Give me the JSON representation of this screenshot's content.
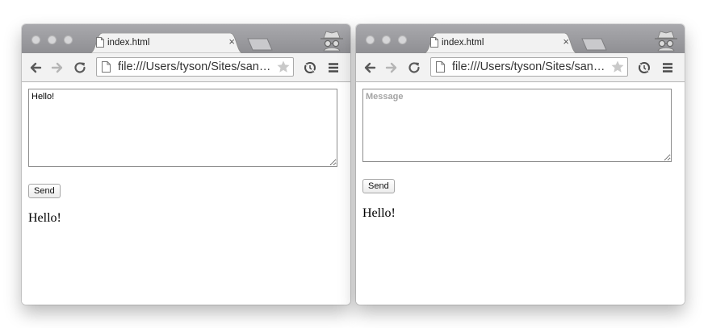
{
  "windows": [
    {
      "tab": {
        "title": "index.html"
      },
      "address_bar": {
        "url": "file:///Users/tyson/Sites/san…"
      },
      "form": {
        "message_value": "Hello!",
        "message_placeholder": "Message",
        "send_label": "Send"
      },
      "output_text": "Hello!"
    },
    {
      "tab": {
        "title": "index.html"
      },
      "address_bar": {
        "url": "file:///Users/tyson/Sites/san…"
      },
      "form": {
        "message_value": "",
        "message_placeholder": "Message",
        "send_label": "Send"
      },
      "output_text": "Hello!"
    }
  ],
  "icons": {
    "tab_close": "×",
    "toolbar": [
      "back-arrow-icon",
      "forward-arrow-icon",
      "reload-icon",
      "star-icon",
      "sync-icon",
      "menu-icon"
    ],
    "incognito": "incognito-icon"
  },
  "colors": {
    "tabstrip": "#9c9ca0",
    "toolbar": "#f2f2f2",
    "forward_disabled": "#b5b5b5"
  }
}
